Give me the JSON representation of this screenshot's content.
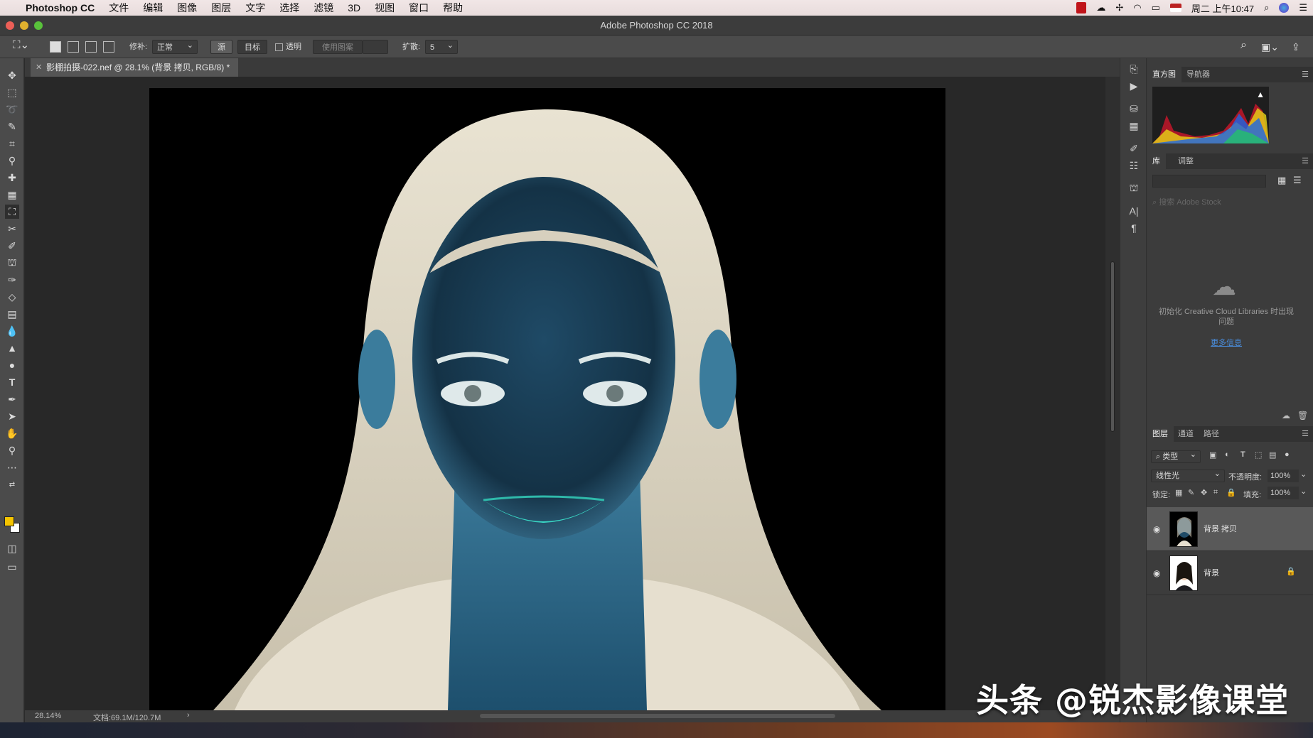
{
  "menubar": {
    "apple": "",
    "app_name": "Photoshop CC",
    "items": [
      "文件",
      "编辑",
      "图像",
      "图层",
      "文字",
      "选择",
      "滤镜",
      "3D",
      "视图",
      "窗口",
      "帮助"
    ],
    "clock": "周二 上午10:47"
  },
  "window": {
    "title": "Adobe Photoshop CC 2018"
  },
  "options": {
    "repair_label": "修补:",
    "repair_mode": "正常",
    "source_label": "源",
    "target_label": "目标",
    "transparent_label": "透明",
    "use_pattern_label": "使用图案",
    "diffusion_label": "扩散:",
    "diffusion_value": "5"
  },
  "document": {
    "tab_title": "影棚拍摄-022.nef @ 28.1% (背景 拷贝, RGB/8) *",
    "zoom": "28.14%",
    "doc_size": "文档:69.1M/120.7M",
    "status_arrow": "›"
  },
  "panels": {
    "top_tabs": [
      "直方图",
      "导航器"
    ],
    "mid_tabs": [
      "库",
      "调整"
    ],
    "library_search_placeholder": "搜索 Adobe Stock",
    "library_message": "初始化 Creative Cloud Libraries 时出现问题",
    "library_link": "更多信息",
    "layers_tabs": [
      "图层",
      "通道",
      "路径"
    ],
    "layer_filter": "类型",
    "blend_mode": "线性光",
    "opacity_label": "不透明度:",
    "opacity_value": "100%",
    "lock_label": "锁定:",
    "fill_label": "填充:",
    "fill_value": "100%",
    "layers": [
      {
        "name": "背景 拷贝",
        "selected": true
      },
      {
        "name": "背景",
        "selected": false,
        "locked": true
      }
    ]
  },
  "watermark": "头条 @锐杰影像课堂",
  "colors": {
    "foreground": "#f5c400",
    "background": "#ffffff",
    "accent": "#4a8fe0"
  }
}
